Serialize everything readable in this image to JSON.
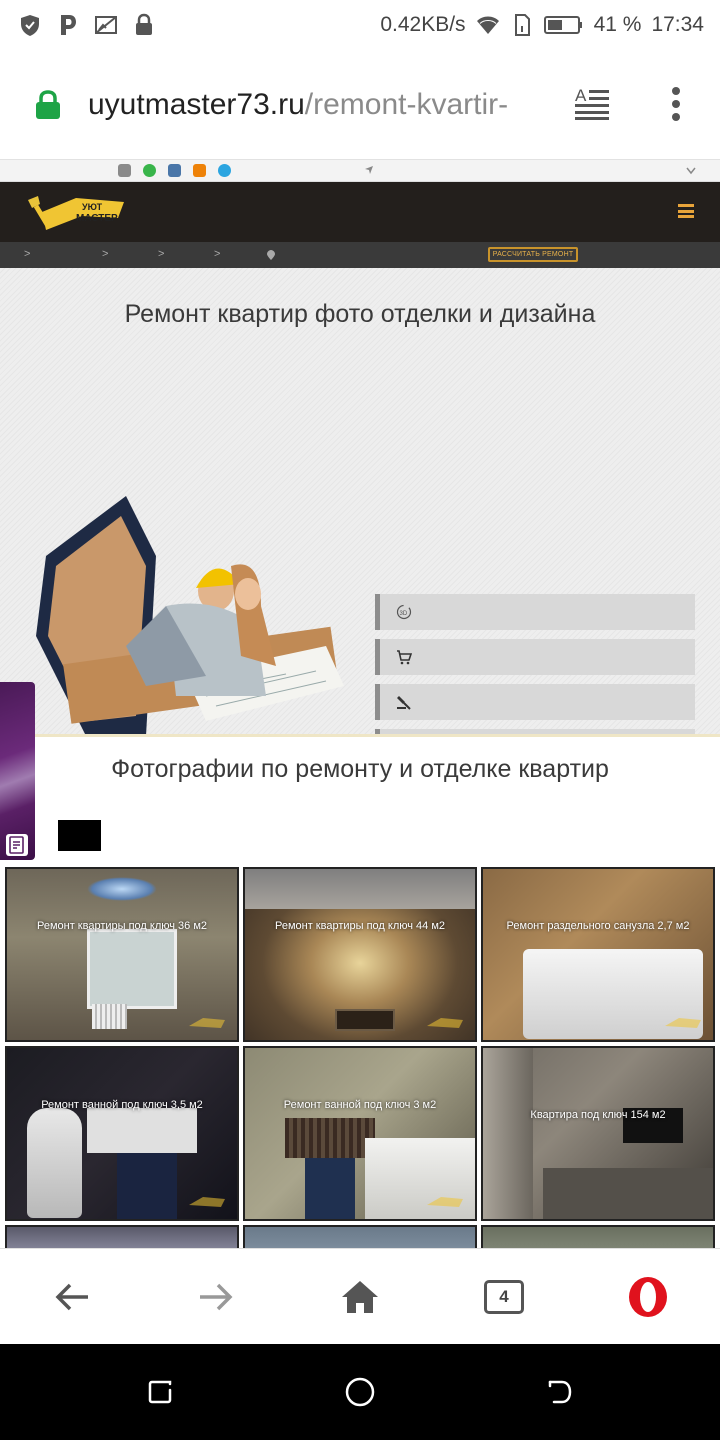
{
  "status_bar": {
    "speed": "0.42KB/s",
    "battery": "41 %",
    "time": "17:34"
  },
  "browser": {
    "url_domain": "uyutmaster73.ru",
    "url_path": "/remont-kvartir-",
    "tab_count": "4"
  },
  "site": {
    "logo_line1": "УЮТ",
    "logo_line2": "МАСТЕР",
    "calc_button": "РАССЧИТАТЬ РЕМОНТ",
    "breadcrumbs": [
      ">",
      ">",
      ">",
      ">"
    ],
    "hero_title": "Ремонт квартир фото отделки и дизайна",
    "menu_items": [
      {
        "icon": "3d-icon",
        "label": ""
      },
      {
        "icon": "cart-icon",
        "label": ""
      },
      {
        "icon": "hammer-icon",
        "label": ""
      },
      {
        "icon": "palette-icon",
        "label": ""
      },
      {
        "icon": "power-icon",
        "label": ""
      }
    ],
    "photos_title": "Фотографии по ремонту и отделке квартир",
    "tiles": [
      {
        "caption": "Ремонт квартиры под ключ 36 м2"
      },
      {
        "caption": "Ремонт квартиры под ключ 44 м2"
      },
      {
        "caption": "Ремонт раздельного санузла 2,7 м2"
      },
      {
        "caption": "Ремонт ванной под ключ 3,5 м2"
      },
      {
        "caption": "Ремонт ванной под ключ 3 м2"
      },
      {
        "caption": "Квартира под ключ 154 м2"
      },
      {
        "caption": ""
      },
      {
        "caption": ""
      },
      {
        "caption": ""
      }
    ]
  },
  "colors": {
    "accent_orange": "#e8a43a",
    "header_dark": "#231f1c",
    "opera_red": "#e0121d",
    "lock_green": "#1ea446"
  }
}
